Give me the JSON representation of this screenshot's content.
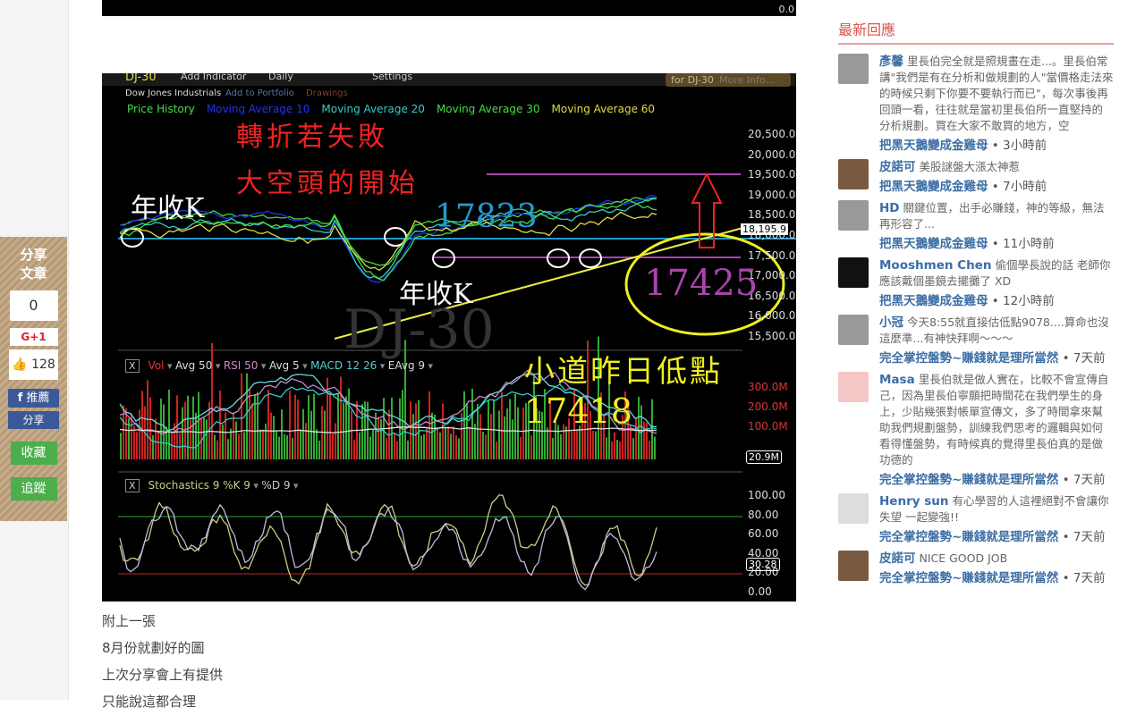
{
  "share": {
    "title1": "分享",
    "title2": "文章",
    "gplus_count": "0",
    "gplus_label": "G+1",
    "like_count": "128",
    "fb_recommend": "推薦",
    "fb_share": "分享",
    "collect": "收藏",
    "follow": "追蹤"
  },
  "chart": {
    "toolbar": {
      "symbol": "DJ-30",
      "add_indicator": "Add Indicator",
      "period": "Daily",
      "settings": "Settings",
      "info": "for DJ-30",
      "more_info": "More Info..."
    },
    "subbar": {
      "name": "Dow Jones Industrials",
      "add_portfolio": "Add to Portfolio",
      "drawings": "Drawings"
    },
    "legend": [
      {
        "label": "Price History",
        "color": "#44dd44"
      },
      {
        "label": "Moving Average 10",
        "color": "#2233ee"
      },
      {
        "label": "Moving Average 20",
        "color": "#33cccc"
      },
      {
        "label": "Moving Average 30",
        "color": "#44dd44"
      },
      {
        "label": "Moving Average 60",
        "color": "#dddd44"
      }
    ],
    "price_axis": [
      "20,500.0",
      "20,000.0",
      "19,500.0",
      "19,000.0",
      "18,500.0",
      "18,000.0",
      "17,500.0",
      "17,000.0",
      "16,500.0",
      "16,000.0",
      "15,500.0"
    ],
    "last_price": "18,195.9",
    "watermark": "DJ-30",
    "annotations": {
      "fail": "轉折若失敗",
      "bear": "大空頭的開始",
      "yearK1": "年收K",
      "yearK2": "年收K",
      "level1": "17823",
      "level2": "17425",
      "low_label": "小道昨日低點",
      "low_value": "17418"
    },
    "vol_panel": {
      "close": "X",
      "legend": [
        "Vol",
        "Avg 50",
        "RSI 50",
        "Avg 5",
        "MACD 12 26",
        "EAvg 9"
      ],
      "axis": [
        "300.0M",
        "200.0M",
        "100.0M"
      ],
      "last": "20.9M",
      "watermark": "Dow Jones Industrials"
    },
    "stoch_panel": {
      "close": "X",
      "legend": [
        "Stochastics 9 %K 9",
        "%D 9"
      ],
      "axis": [
        "100.00",
        "80.00",
        "60.00",
        "40.00",
        "20.00",
        "0.00"
      ],
      "last": "30.28"
    },
    "top_strip_value": "0.0"
  },
  "post": {
    "lines": [
      "附上一張",
      "8月份就劃好的圖",
      "上次分享會上有提供",
      "只能說這都合理"
    ]
  },
  "sidebar": {
    "title": "最新回應",
    "comments": [
      {
        "name": "彥馨",
        "text": "里長伯完全就是照規畫在走...。里長伯常講\"我們是有在分析和做規劃的人\"當價格走法來的時候只剩下你要不要執行而已\"，每次事後再回頭一看，往往就是當初里長伯所一直堅持的分析規劃。買在大家不敢買的地方，空",
        "post": "把黑天鵝變成金雞母",
        "time": "3小時前",
        "avatar": "default"
      },
      {
        "name": "皮諾可",
        "text": "美股謎盤大漲太神惹",
        "post": "把黑天鵝變成金雞母",
        "time": "7小時前",
        "avatar": "photo"
      },
      {
        "name": "HD",
        "text": "關鍵位置，出手必賺錢，神的等級，無法再形容了...",
        "post": "把黑天鵝變成金雞母",
        "time": "11小時前",
        "avatar": "default"
      },
      {
        "name": "Mooshmen Chen",
        "text": "偷個學長說的話 老師你應該戴個墨鏡去擺攤了 XD",
        "post": "把黑天鵝變成金雞母",
        "time": "12小時前",
        "avatar": "dark"
      },
      {
        "name": "小冠",
        "text": "今天8:55就直接估低點9078....算命也沒這麼準...有神快拜啊～～～",
        "post": "完全掌控盤勢~賺錢就是理所當然",
        "time": "7天前",
        "avatar": "default"
      },
      {
        "name": "Masa",
        "text": "里長伯就是做人實在，比較不會宣傳自己，因為里長伯寧願把時間花在我們學生的身上，少貼幾張對帳單宣傳文，多了時間拿來幫助我們規劃盤勢，訓練我們思考的邏輯與如何看得懂盤勢，有時候真的覺得里長伯真的是做功德的",
        "post": "完全掌控盤勢~賺錢就是理所當然",
        "time": "7天前",
        "avatar": "pink"
      },
      {
        "name": "Henry sun",
        "text": "有心學習的人這裡絕對不會讓你失望 一起變強!!",
        "post": "完全掌控盤勢~賺錢就是理所當然",
        "time": "7天前",
        "avatar": "dog"
      },
      {
        "name": "皮諾可",
        "text": "NICE GOOD JOB",
        "post": "完全掌控盤勢~賺錢就是理所當然",
        "time": "7天前",
        "avatar": "photo"
      }
    ]
  }
}
